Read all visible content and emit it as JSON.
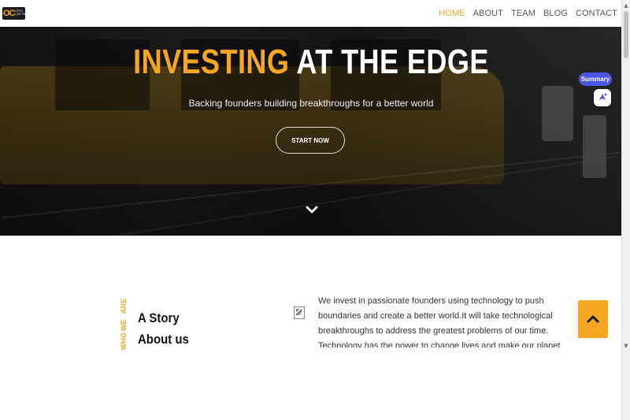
{
  "logo": {
    "mark": "OC",
    "text": "OPEN CAPITAL"
  },
  "nav": {
    "items": [
      {
        "label": "HOME",
        "active": true
      },
      {
        "label": "ABOUT",
        "active": false
      },
      {
        "label": "TEAM",
        "active": false
      },
      {
        "label": "BLOG",
        "active": false
      },
      {
        "label": "CONTACT",
        "active": false
      }
    ]
  },
  "hero": {
    "title_accent": "INVESTING",
    "title_rest": "AT THE EDGE",
    "subtitle": "Backing founders building breakthroughs for a better world",
    "cta_label": "START NOW",
    "scroll_icon": "chevron-down-icon"
  },
  "widget": {
    "summary_label": "Summary",
    "assistant_icon": "assistant-icon"
  },
  "about": {
    "vertical_words": [
      "WHO",
      "WE",
      "ARE"
    ],
    "heading_line1": "A Story",
    "heading_line2": "About us",
    "body": "We invest in passionate founders using technology to push boundaries and create a better world.It will take technological breakthroughs to address the greatest problems of our time. Technology has the power to change lives and make our planet greener - but technology alone can't make that happen. The"
  },
  "back_to_top_icon": "chevron-up-icon",
  "colors": {
    "accent": "#f5a623",
    "nav_text": "#555555",
    "summary_pill": "#4a56e2",
    "hero_overlay": "#000000"
  }
}
